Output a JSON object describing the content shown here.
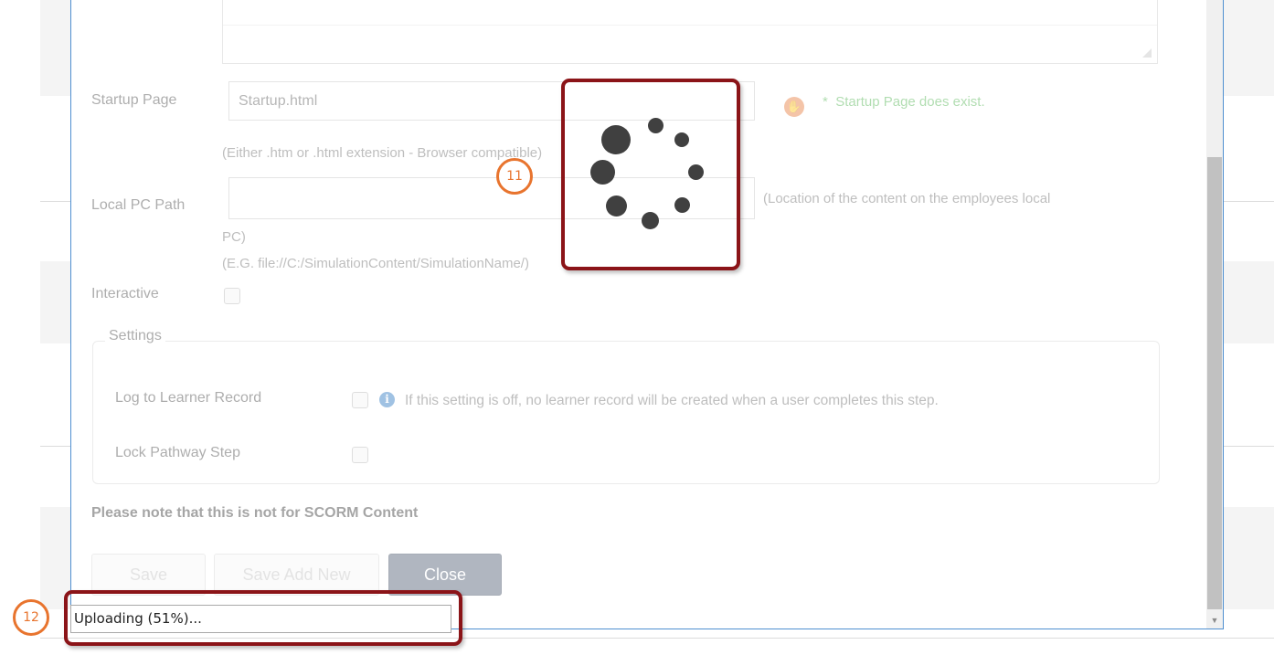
{
  "form": {
    "startup_page_label": "Startup Page",
    "startup_page_value": "Startup.html",
    "startup_page_status_asterisk": "*",
    "startup_page_status": "Startup Page does exist.",
    "startup_hint": "(Either .htm or .html extension - Browser compatible)",
    "local_path_label": "Local PC Path",
    "local_path_value": "",
    "local_path_hint": "(Location of the content on the employees local",
    "local_path_hint_cont": "PC)",
    "local_path_example": "(E.G. file://C:/SimulationContent/SimulationName/)",
    "interactive_label": "Interactive"
  },
  "settings": {
    "legend": "Settings",
    "log_label": "Log to Learner Record",
    "log_info": "If this setting is off, no learner record will be created when a user completes this step.",
    "lock_label": "Lock Pathway Step"
  },
  "note": "Please note that this is not for SCORM Content",
  "buttons": {
    "save": "Save",
    "save_add_new": "Save Add New",
    "close": "Close"
  },
  "status": {
    "upload_text": "Uploading (51%)...",
    "upload_progress_percent": 51
  },
  "callouts": {
    "spinner_number": "11",
    "upload_number": "12"
  },
  "icons": {
    "success": "hand-icon",
    "info": "info-icon"
  },
  "colors": {
    "callout_border": "#8b1418",
    "callout_number": "#e8742e",
    "success_text": "#5cb85c",
    "modal_border": "#4f8fd0"
  }
}
